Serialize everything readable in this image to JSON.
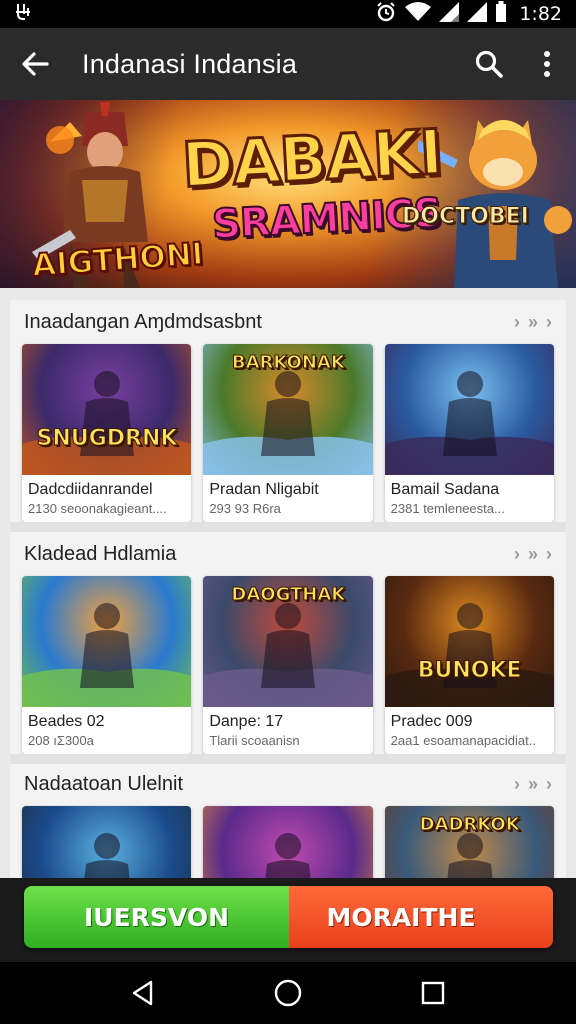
{
  "status_bar": {
    "time": "1:82"
  },
  "app_bar": {
    "title": "Indanasi Indansia"
  },
  "banner": {
    "title": "DABAKI",
    "subtitle": "SRAMNICS",
    "left_label": "AIGTHONI",
    "right_label": "DOCTOBEI"
  },
  "sections": [
    {
      "title": "Inaadangan Aɱdmdsasbnt",
      "cards": [
        {
          "art_text": "SNUGDRNK",
          "title": "Dadcdiidanrandel",
          "subtitle": "2130 seoonakagieant....",
          "colors": [
            "#3b2a6a",
            "#7a3fa0",
            "#c0561e"
          ]
        },
        {
          "art_text": "BARKONAK",
          "title": "Pradan Nligabit",
          "subtitle": "293 93 R6ra",
          "colors": [
            "#4a7a2a",
            "#d98a2a",
            "#88c0e8"
          ]
        },
        {
          "art_text": "",
          "title": "Bamail Sadana",
          "subtitle": "2381 temleneesta...",
          "colors": [
            "#2a5aa0",
            "#7ac0f0",
            "#3a2a5a"
          ]
        }
      ]
    },
    {
      "title": "Kladead Hdlamia",
      "cards": [
        {
          "art_text": "",
          "title": "Beades 02",
          "subtitle": "208 ıΣ300a",
          "colors": [
            "#2a7ad0",
            "#f0a040",
            "#70c050"
          ]
        },
        {
          "art_text": "DAOGTHAK",
          "title": "Danpe: 17",
          "subtitle": "Tlarii scoaanisn",
          "colors": [
            "#3a4a6a",
            "#c04a3a",
            "#6a5a8a"
          ]
        },
        {
          "art_text": "BUNOKE",
          "title": "Pradec 009",
          "subtitle": "2aa1 esoamanapacidiat..",
          "colors": [
            "#5a2a10",
            "#e08a20",
            "#2a1a10"
          ]
        }
      ]
    },
    {
      "title": "Nadaatoan Ulelnit",
      "cards": [
        {
          "art_text": "",
          "title": "",
          "subtitle": "",
          "colors": [
            "#1a4a8a",
            "#5ab0e0",
            "#203040"
          ]
        },
        {
          "art_text": "",
          "title": "",
          "subtitle": "",
          "colors": [
            "#5a2a8a",
            "#c04ab0",
            "#e08a3a"
          ]
        },
        {
          "art_text": "DADRKOK",
          "title": "",
          "subtitle": "",
          "colors": [
            "#3a5a7a",
            "#c08a4a",
            "#6a3a2a"
          ]
        }
      ]
    }
  ],
  "cta": {
    "left_label": "IUERSVON",
    "right_label": "MORAITHE"
  },
  "colors": {
    "app_bar": "#2b2b2b",
    "cta_green": "#3fbf2a",
    "cta_orange": "#f0502a"
  }
}
